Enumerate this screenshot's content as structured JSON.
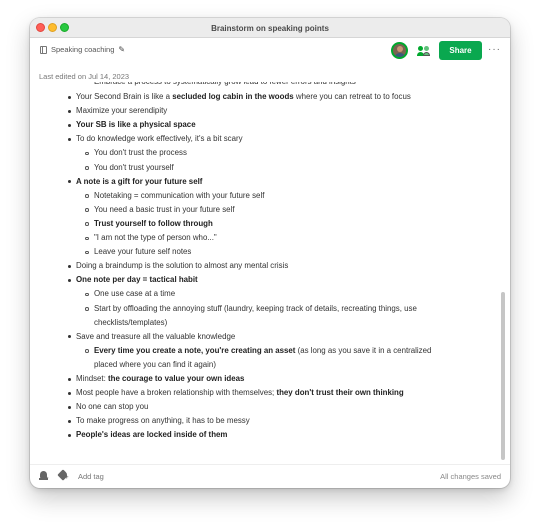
{
  "window": {
    "title": "Brainstorm on speaking points"
  },
  "toolbar": {
    "notebook_label": "Speaking coaching",
    "share_label": "Share",
    "more_label": "···"
  },
  "meta": {
    "last_edited": "Last edited on Jul 14, 2023"
  },
  "note": {
    "cut_top_line": "Embrace a process to systematically grow lead to fewer errors and insights",
    "lines": [
      {
        "level": 1,
        "segments": [
          {
            "t": "Your Second Brain is like a "
          },
          {
            "t": "secluded log cabin in the woods",
            "b": true
          },
          {
            "t": " where you can retreat to to focus"
          }
        ]
      },
      {
        "level": 1,
        "segments": [
          {
            "t": "Maximize your serendipity"
          }
        ]
      },
      {
        "level": 1,
        "segments": [
          {
            "t": "Your SB is like a physical space",
            "b": true
          }
        ]
      },
      {
        "level": 1,
        "segments": [
          {
            "t": "To do knowledge work effectively, it's a bit scary"
          }
        ]
      },
      {
        "level": 2,
        "segments": [
          {
            "t": "You don't trust the process"
          }
        ]
      },
      {
        "level": 2,
        "segments": [
          {
            "t": "You don't trust yourself"
          }
        ]
      },
      {
        "level": 1,
        "segments": [
          {
            "t": "A note is a gift for your future self",
            "b": true
          }
        ]
      },
      {
        "level": 2,
        "segments": [
          {
            "t": "Notetaking = communication with your future self"
          }
        ]
      },
      {
        "level": 2,
        "segments": [
          {
            "t": "You need a basic trust in your future self"
          }
        ]
      },
      {
        "level": 2,
        "segments": [
          {
            "t": "Trust yourself to follow through",
            "b": true
          }
        ]
      },
      {
        "level": 2,
        "segments": [
          {
            "t": "\"I am not the type of person who...\""
          }
        ]
      },
      {
        "level": 2,
        "segments": [
          {
            "t": "Leave your future self notes"
          }
        ]
      },
      {
        "level": 1,
        "segments": [
          {
            "t": "Doing a braindump is the solution to almost any mental crisis"
          }
        ]
      },
      {
        "level": 1,
        "segments": [
          {
            "t": "One note per day = tactical habit",
            "b": true
          }
        ]
      },
      {
        "level": 2,
        "segments": [
          {
            "t": "One use case at a time"
          }
        ]
      },
      {
        "level": 2,
        "segments": [
          {
            "t": "Start by offloading the annoying stuff (laundry, keeping track of details, recreating things, use"
          }
        ]
      },
      {
        "level": 0,
        "segments": [
          {
            "t": "checklists/templates)"
          }
        ]
      },
      {
        "level": 1,
        "segments": [
          {
            "t": "Save and treasure all the valuable knowledge"
          }
        ]
      },
      {
        "level": 2,
        "segments": [
          {
            "t": "Every time you create a note, you're creating an asset",
            "b": true
          },
          {
            "t": " (as long as you save it in a centralized"
          }
        ]
      },
      {
        "level": 0,
        "segments": [
          {
            "t": "placed where you can find it again)"
          }
        ]
      },
      {
        "level": 1,
        "segments": [
          {
            "t": "Mindset: "
          },
          {
            "t": "the courage to value your own ideas",
            "b": true
          }
        ]
      },
      {
        "level": 1,
        "segments": [
          {
            "t": "Most people have a broken relationship with themselves; "
          },
          {
            "t": "they don't trust their own thinking",
            "b": true
          }
        ]
      },
      {
        "level": 1,
        "segments": [
          {
            "t": "No one can stop you"
          }
        ]
      },
      {
        "level": 1,
        "segments": [
          {
            "t": "To make progress on anything, it has to be messy"
          }
        ]
      },
      {
        "level": 1,
        "segments": [
          {
            "t": "People's ideas are locked inside of them",
            "b": true
          }
        ]
      }
    ]
  },
  "footer": {
    "add_tag_label": "Add tag",
    "status": "All changes saved"
  },
  "colors": {
    "accent": "#0aa84f",
    "avatar_ring": "#00a82d"
  },
  "icons": [
    "notebook-icon",
    "pencil-icon",
    "avatar",
    "share-people-icon",
    "more-icon",
    "reminder-bell-icon",
    "tag-icon"
  ]
}
